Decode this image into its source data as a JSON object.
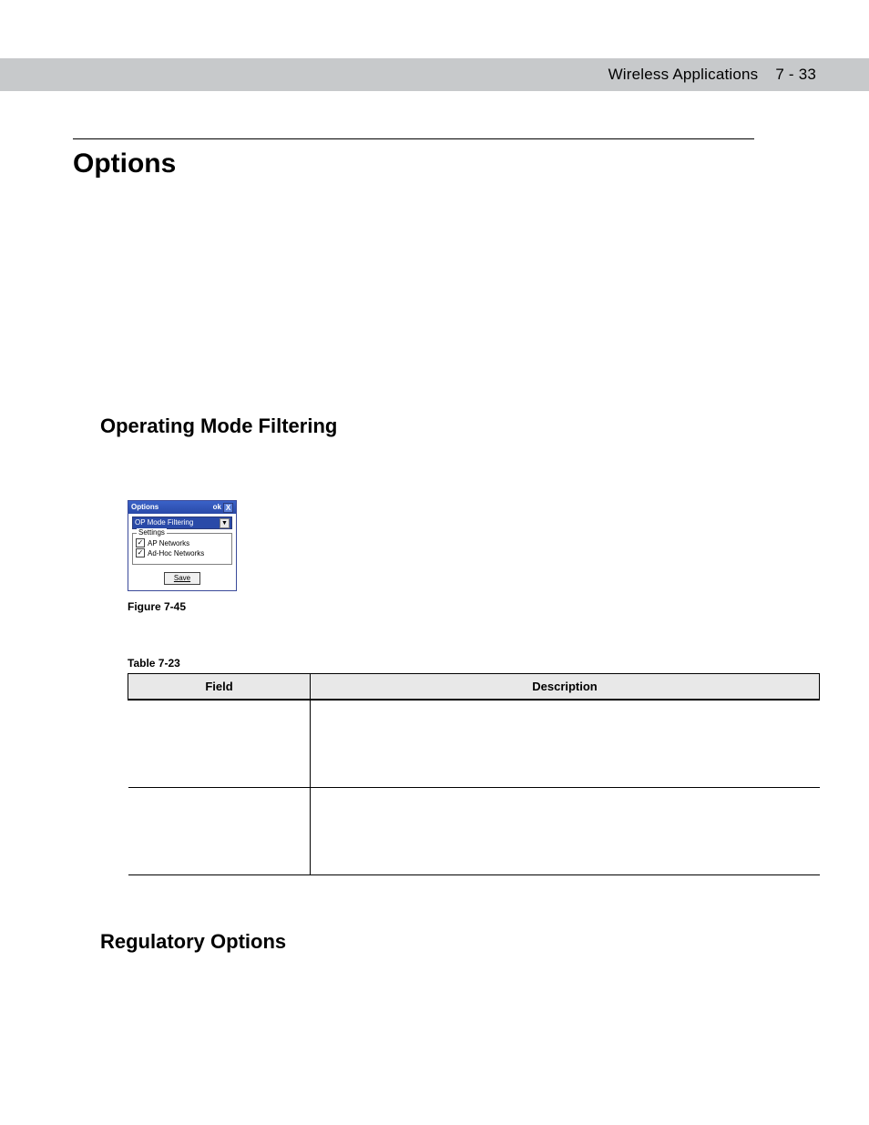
{
  "header": {
    "chapter": "Wireless Applications",
    "page": "7 - 33"
  },
  "section_title": "Options",
  "subsection_1": "Operating Mode Filtering",
  "subsection_2": "Regulatory Options",
  "figure_caption": "Figure 7-45",
  "table_caption": "Table 7-23",
  "table_headers": {
    "field": "Field",
    "description": "Description"
  },
  "dialog": {
    "title": "Options",
    "ok": "ok",
    "close": "X",
    "dropdown_value": "OP Mode Filtering",
    "dropdown_arrow": "▼",
    "group_label": "Settings",
    "check1_label": "AP Networks",
    "check2_label": "Ad-Hoc Networks",
    "check_mark": "✓",
    "save": "Save"
  }
}
